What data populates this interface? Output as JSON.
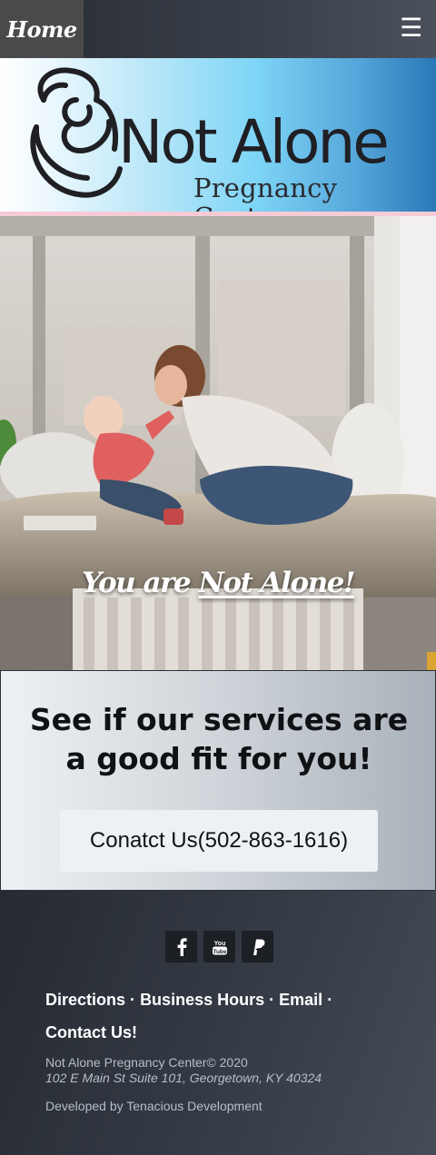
{
  "nav": {
    "home_label": "Home",
    "menu_icon": "hamburger-menu-icon",
    "menu_glyph": "☰"
  },
  "banner": {
    "logo_title": "Not Alone",
    "logo_subtitle": "Pregnancy Center",
    "logo_icon": "mother-and-baby-icon"
  },
  "hero": {
    "caption_prefix": "You are",
    "caption_emphasis": "Not Alone!"
  },
  "services": {
    "heading": "See if our services are a good fit for you!",
    "contact_button": "Conatct Us(502-863-1616)"
  },
  "footer": {
    "social": [
      {
        "name": "facebook-icon"
      },
      {
        "name": "youtube-icon"
      },
      {
        "name": "paypal-icon"
      }
    ],
    "links": {
      "directions": "Directions",
      "business_hours": "Business Hours",
      "email": "Email",
      "contact": "Contact Us!",
      "separator": "·"
    },
    "org_line": "Not Alone Pregnancy Center© 2020",
    "address": "102 E Main St Suite 101, Georgetown, KY 40324",
    "developer": "Developed by Tenacious Development"
  },
  "colors": {
    "nav_bg": "#2f343c",
    "home_tab_bg": "#4a4a4c",
    "banner_blue": "#2a77b7",
    "banner_stripe": "#f6cbd6",
    "footer_bg": "#323842",
    "button_bg": "#eef1f4"
  }
}
